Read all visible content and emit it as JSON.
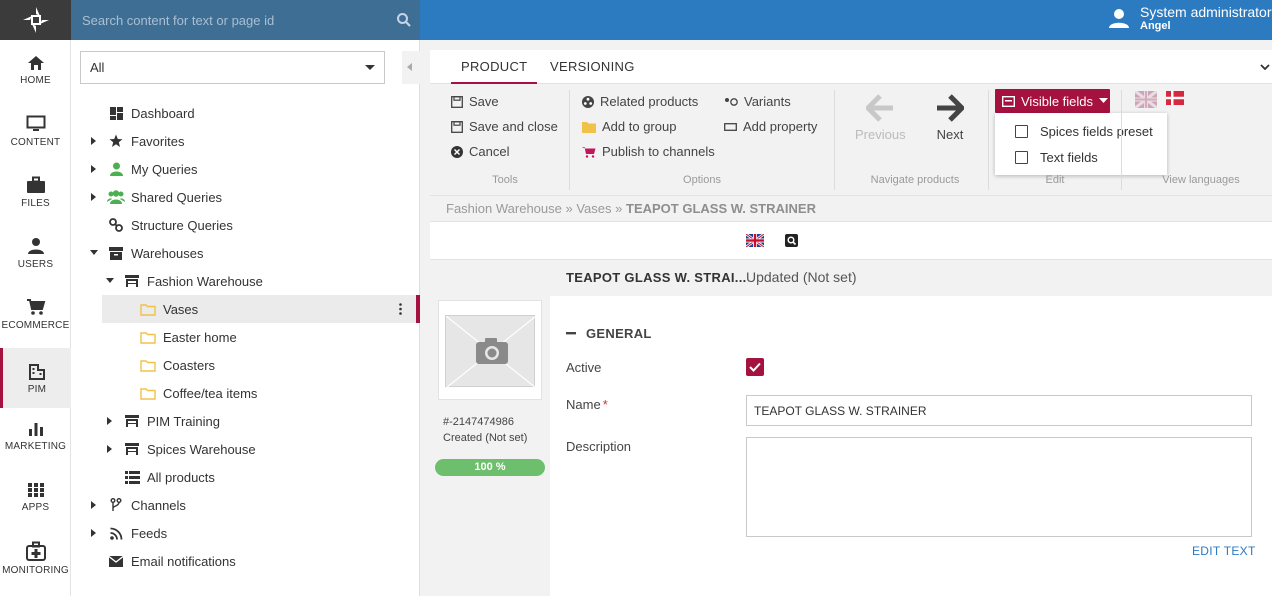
{
  "topbar": {
    "search_placeholder": "Search content for text or page id",
    "user_name": "System administrator",
    "user_sub": "Angel"
  },
  "leftnav": [
    {
      "label": "HOME",
      "icon": "home-icon"
    },
    {
      "label": "CONTENT",
      "icon": "monitor-icon"
    },
    {
      "label": "FILES",
      "icon": "briefcase-icon"
    },
    {
      "label": "USERS",
      "icon": "user-icon"
    },
    {
      "label": "ECOMMERCE",
      "icon": "cart-icon"
    },
    {
      "label": "PIM",
      "icon": "building-icon",
      "active": true
    },
    {
      "label": "MARKETING",
      "icon": "bar-chart-icon"
    },
    {
      "label": "APPS",
      "icon": "grid-icon"
    },
    {
      "label": "MONITORING",
      "icon": "first-aid-icon"
    }
  ],
  "tree": {
    "filter": "All",
    "items": [
      {
        "label": "Dashboard"
      },
      {
        "label": "Favorites"
      },
      {
        "label": "My Queries"
      },
      {
        "label": "Shared Queries"
      },
      {
        "label": "Structure Queries"
      },
      {
        "label": "Warehouses"
      },
      {
        "label": "Fashion Warehouse"
      },
      {
        "label": "Vases"
      },
      {
        "label": "Easter home"
      },
      {
        "label": "Coasters"
      },
      {
        "label": "Coffee/tea items"
      },
      {
        "label": "PIM Training"
      },
      {
        "label": "Spices Warehouse"
      },
      {
        "label": "All products"
      },
      {
        "label": "Channels"
      },
      {
        "label": "Feeds"
      },
      {
        "label": "Email notifications"
      }
    ]
  },
  "tabs": [
    "PRODUCT",
    "VERSIONING"
  ],
  "ribbon": {
    "tools": {
      "save": "Save",
      "save_close": "Save and close",
      "cancel": "Cancel",
      "group": "Tools"
    },
    "options": {
      "related": "Related products",
      "add_group": "Add to group",
      "publish": "Publish to channels",
      "variants": "Variants",
      "add_property": "Add property",
      "group": "Options"
    },
    "navigate": {
      "previous": "Previous",
      "next": "Next",
      "group": "Navigate products"
    },
    "edit": {
      "visible_fields": "Visible fields",
      "group": "Edit",
      "menu": [
        "Spices fields preset",
        "Text fields"
      ]
    },
    "languages": {
      "group": "View languages"
    }
  },
  "breadcrumb": {
    "part1": "Fashion Warehouse",
    "sep": "»",
    "part2": "Vases",
    "current": "TEAPOT GLASS W. STRAINER"
  },
  "product": {
    "title": "TEAPOT GLASS W. STRAI...",
    "updated": "Updated (Not set)",
    "id": "#-2147474986",
    "created": "Created (Not set)",
    "progress": "100 %",
    "progress_value": 100
  },
  "form": {
    "section": "GENERAL",
    "active_label": "Active",
    "active_checked": true,
    "name_label": "Name",
    "name_required": "*",
    "name_value": "TEAPOT GLASS W. STRAINER",
    "description_label": "Description",
    "description_value": "",
    "edit_text": "EDIT TEXT"
  },
  "colors": {
    "accent": "#a6123f",
    "topbar": "#2c7bc1",
    "success": "#6dbf6d"
  }
}
